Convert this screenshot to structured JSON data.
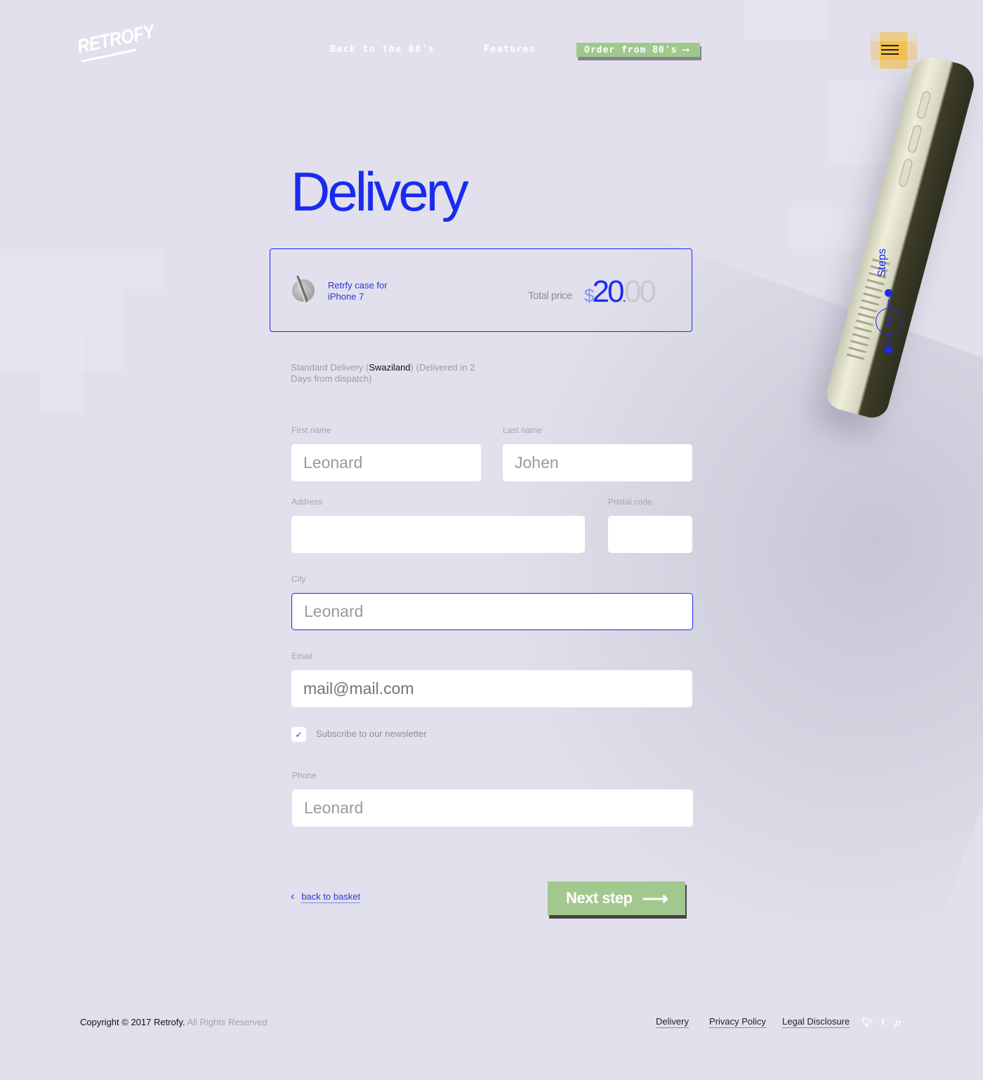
{
  "header": {
    "logo": "RETROFY",
    "nav": [
      {
        "label": "Back to the 80's"
      },
      {
        "label": "Features"
      }
    ],
    "order_button": {
      "label": "Order from 80's",
      "icon": "arrow-right-icon"
    },
    "menu_icon": "hamburger-menu-icon",
    "menu_color": "#f2c04f"
  },
  "steps": {
    "label": "Steps",
    "current": "2"
  },
  "main": {
    "title": "Delivery",
    "cart": {
      "product_name": "Retrfy case for iPhone 7",
      "total_label": "Total price",
      "currency": "$",
      "price_int": "20",
      "price_sep": ".",
      "price_dec": "00"
    },
    "delivery_info": {
      "prefix": "Standard Delivery (",
      "country": "Swaziland",
      "suffix": ") (Delivered in 2 Days from dispatch)"
    },
    "form": {
      "first_name": {
        "label": "First name",
        "value": "Leonard"
      },
      "last_name": {
        "label": "Last name",
        "value": "Johen"
      },
      "address": {
        "label": "Address",
        "value": ""
      },
      "postal_code": {
        "label": "Postal code",
        "value": ""
      },
      "city": {
        "label": "City",
        "value": "Leonard"
      },
      "email": {
        "label": "Email",
        "placeholder": "mail@mail.com"
      },
      "newsletter": {
        "label": "Subscribe to our newsletter",
        "checked": true,
        "check_glyph": "✓"
      },
      "phone": {
        "label": "Phone",
        "value": "Leonard"
      }
    },
    "back_link": "back to basket",
    "next_button": "Next step"
  },
  "footer": {
    "copyright": "Copyright © 2017 Retrofy.",
    "rights": "All Rights Reserved",
    "links": [
      "Delivery",
      "Privacy Policy",
      "Legal Disclosure"
    ],
    "social": [
      "twitter-icon",
      "facebook-icon",
      "pinterest-icon"
    ]
  },
  "colors": {
    "accent_blue": "#1a2bf0",
    "button_green": "#a3c88e",
    "background": "#e1e0ec"
  }
}
